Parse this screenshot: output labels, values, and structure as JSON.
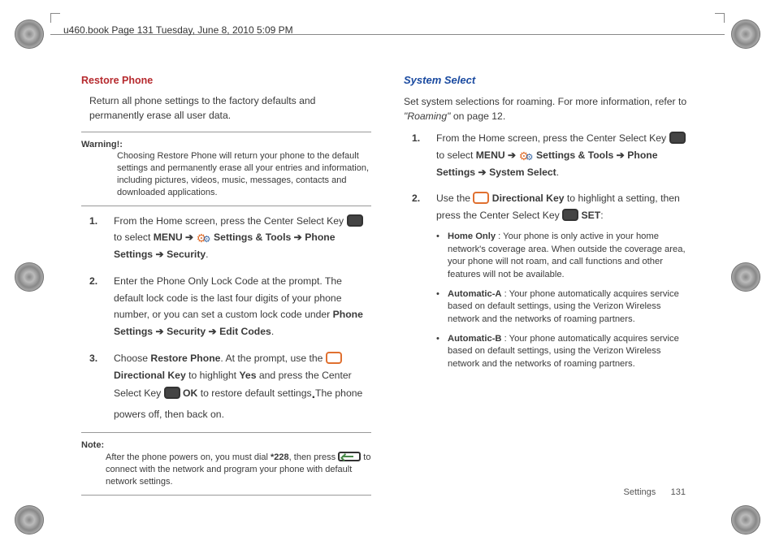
{
  "bookmark": "u460.book  Page 131  Tuesday, June 8, 2010  5:09 PM",
  "left": {
    "heading": "Restore Phone",
    "intro": "Return all phone settings to the factory defaults and permanently erase all user data.",
    "warning_label": "Warning!:",
    "warning_text": "Choosing Restore Phone will return your phone to the default settings and permanently erase all your entries and information, including pictures, videos, music, messages, contacts and downloaded applications.",
    "steps": {
      "n1": "1.",
      "s1a": "From the Home screen, press the Center Select Key ",
      "s1b": " to select ",
      "menu": "MENU",
      "arrow": " ➔ ",
      "st": " Settings & Tools",
      "ps": "Phone Settings",
      "sec": "Security",
      "dot": ".",
      "n2": "2.",
      "s2a": "Enter the Phone Only Lock Code at the prompt. The default lock code is the last four digits of your phone number, or you can set a custom lock code under ",
      "ps2": "Phone Settings",
      "sec2": "Security",
      "ec": "Edit Codes",
      "n3": "3.",
      "s3a": "Choose ",
      "rp": "Restore Phone",
      "s3b": ". At the prompt, use the ",
      "dk": " Directional Key",
      "s3c": " to highlight ",
      "yes": "Yes",
      "s3d": " and press the Center Select Key ",
      "ok": " OK",
      "s3e": " to restore default settings",
      "s3f": "The phone powers off, then back on."
    },
    "note_label": "Note:",
    "note_a": "After the phone powers on, you must dial ",
    "note_star": "*228",
    "note_b": ", then press ",
    "note_c": " to connect with the network and program your phone with default network settings."
  },
  "right": {
    "heading": "System Select",
    "intro_a": "Set system selections for roaming. For more information, refer to ",
    "intro_ref": "\"Roaming\" ",
    "intro_b": " on page 12.",
    "steps": {
      "n1": "1.",
      "s1a": "From the Home screen, press the Center Select Key ",
      "s1b": " to select ",
      "menu": "MENU",
      "arrow": " ➔ ",
      "st": " Settings & Tools",
      "ps": "Phone Settings",
      "ss": "System Select",
      "dot": ".",
      "n2": "2.",
      "s2a": "Use the ",
      "dk": " Directional Key",
      "s2b": " to highlight a setting, then press the Center Select Key ",
      "set": " SET",
      "colon": ":"
    },
    "bullets": {
      "b1t": "Home Only",
      "b1": " : Your phone is only active in your home network's coverage area. When outside the coverage area, your phone will not roam, and call functions and other features will not be available.",
      "b2t": "Automatic-A",
      "b2": " : Your phone automatically acquires service based on default settings, using the Verizon Wireless network and the networks of roaming partners.",
      "b3t": "Automatic-B",
      "b3": " : Your phone automatically acquires service based on default settings, using the Verizon Wireless network and the networks of roaming partners."
    }
  },
  "footer": {
    "section": "Settings",
    "page": "131"
  }
}
